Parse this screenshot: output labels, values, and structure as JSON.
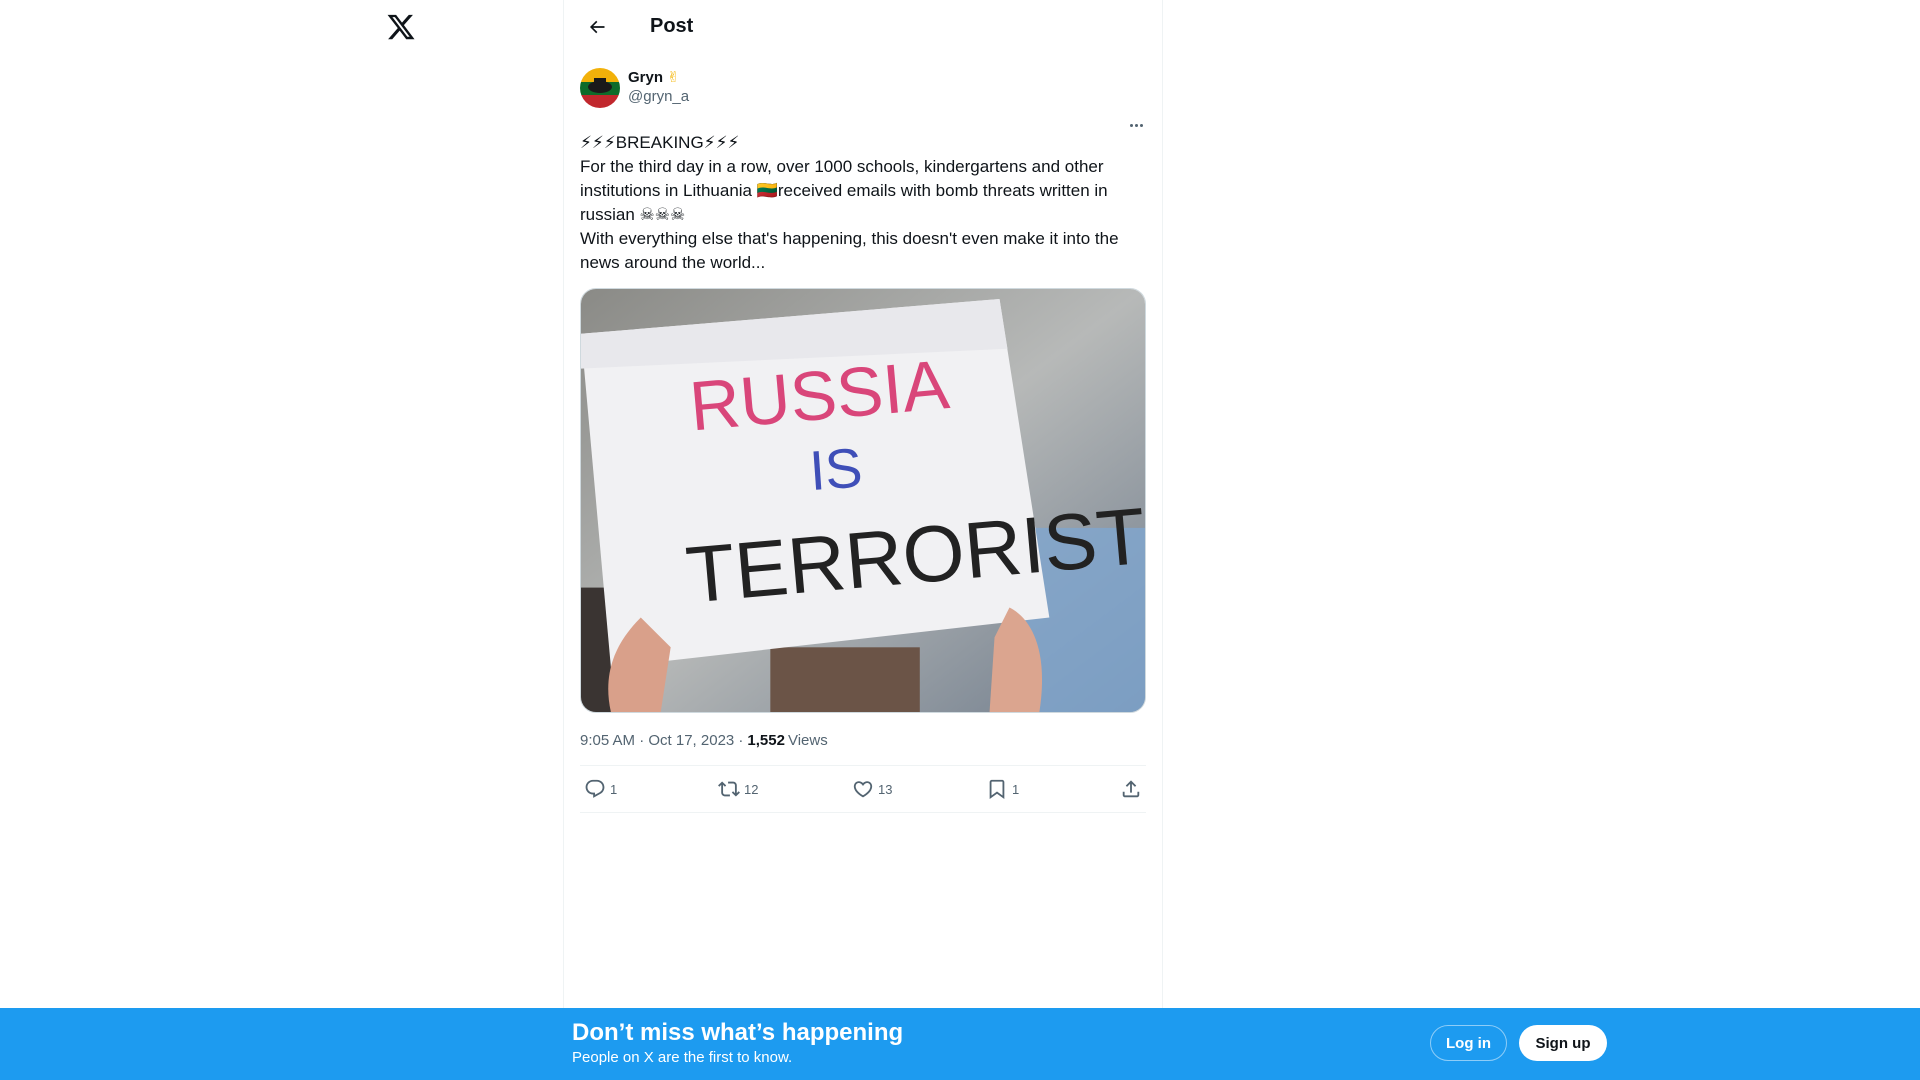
{
  "header": {
    "title": "Post"
  },
  "post": {
    "author_name": "Gryn",
    "author_emoji": "✌",
    "author_handle": "@gryn_a",
    "text_lines": [
      "⚡⚡⚡BREAKING⚡⚡⚡",
      "For the third day in a row, over 1000 schools, kindergartens and other",
      "institutions in Lithuania 🇱🇹received emails with bomb threats written in",
      "russian ☠☠☠",
      "With everything else that's happening, this doesn't even make it into the",
      "news around the world..."
    ],
    "image": {
      "sign_line1": "RUSSIA",
      "sign_line2": "IS",
      "sign_line3": "TERRORIST"
    },
    "timestamp": "9:05 AM · Oct 17, 2023 · ",
    "views_count": "1,552",
    "views_label": "Views"
  },
  "actions": {
    "reply_count": "1",
    "repost_count": "12",
    "like_count": "13",
    "bookmark_count": "1"
  },
  "banner": {
    "title": "Don’t miss what’s happening",
    "subtitle": "People on X are the first to know.",
    "login_label": "Log in",
    "signup_label": "Sign up"
  },
  "colors": {
    "accent": "#1d9bf0",
    "text": "#0f1419",
    "secondary": "#536471"
  }
}
